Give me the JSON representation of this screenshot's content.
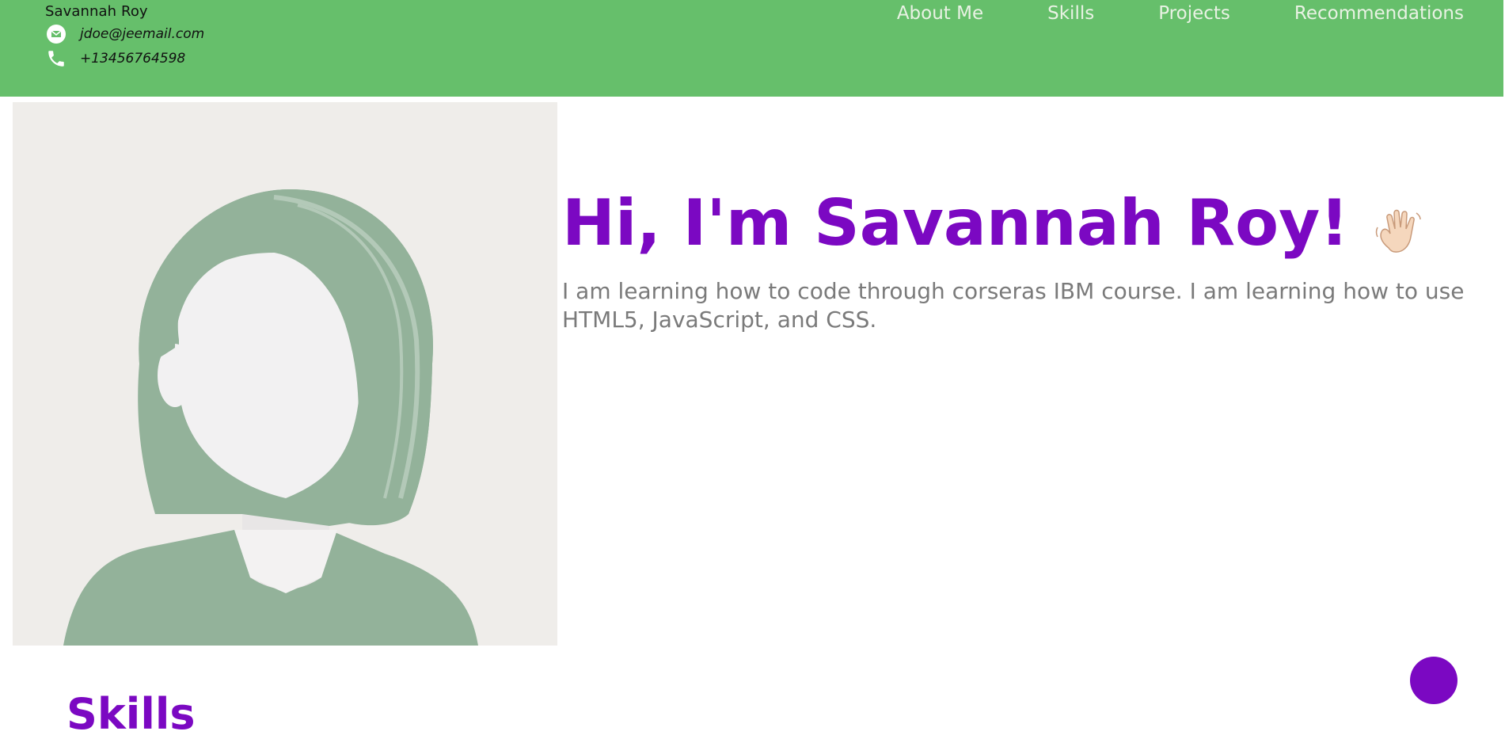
{
  "header": {
    "name": "Savannah Roy",
    "email": "jdoe@jeemail.com",
    "phone": "+13456764598",
    "email_icon": "mail-icon",
    "phone_icon": "phone-icon",
    "background_color": "#66bf6b"
  },
  "nav": {
    "items": [
      {
        "label": "About Me"
      },
      {
        "label": "Skills"
      },
      {
        "label": "Projects"
      },
      {
        "label": "Recommendations"
      }
    ]
  },
  "hero": {
    "title": "Hi, I'm Savannah Roy!",
    "wave_icon": "waving-hand-icon",
    "description": "I am learning how to code through corseras IBM course. I am learning how to use HTML5, JavaScript, and CSS.",
    "accent_color": "#7b08c2"
  },
  "profile": {
    "image_icon": "avatar-placeholder"
  },
  "skills": {
    "heading": "Skills"
  }
}
